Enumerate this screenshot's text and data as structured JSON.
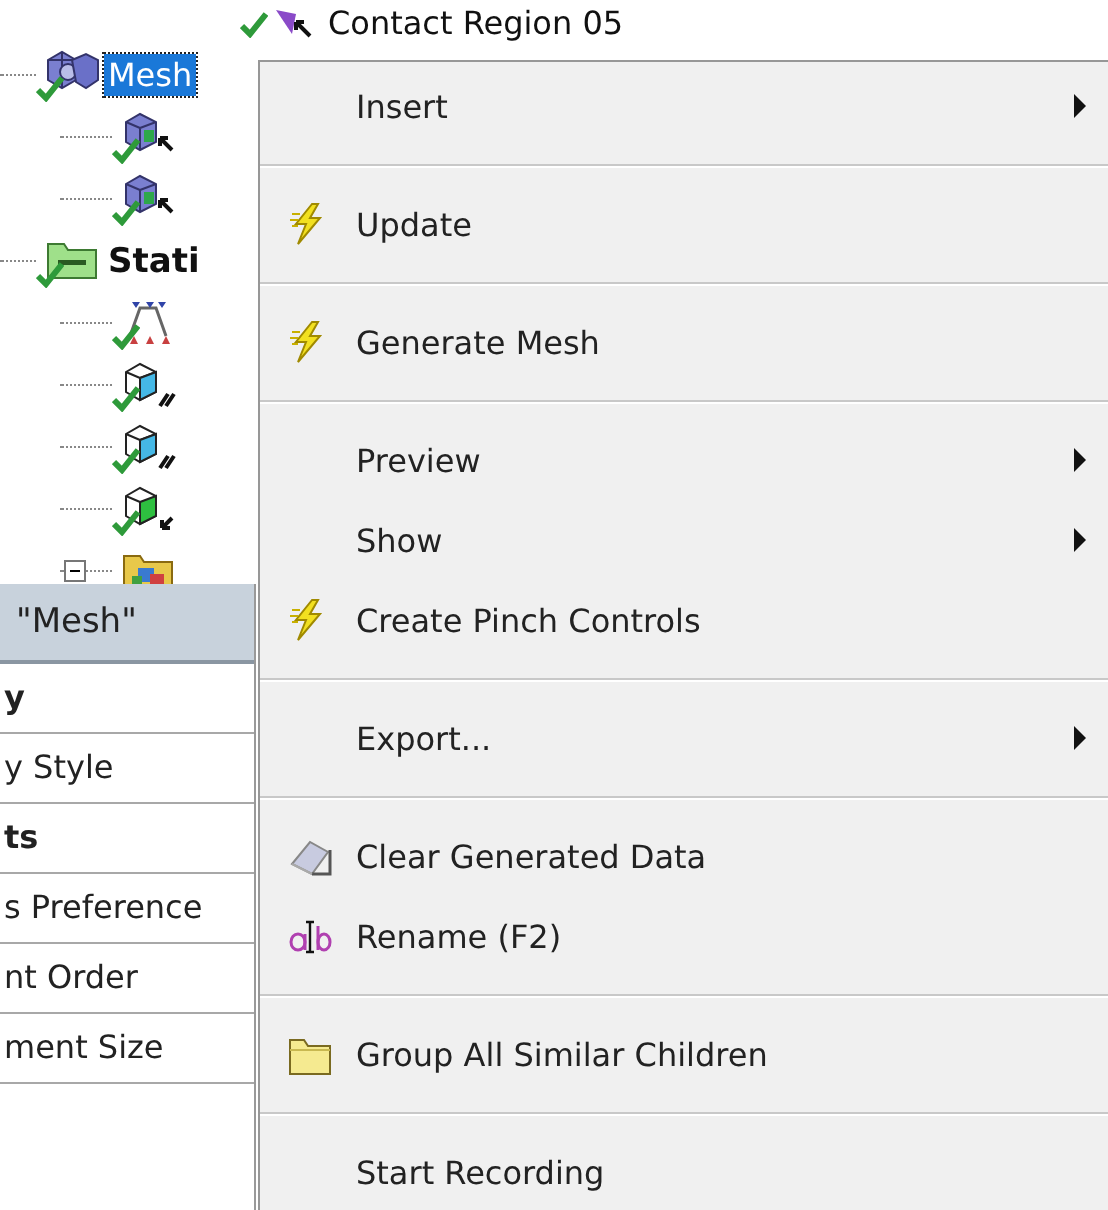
{
  "tree": {
    "above_item": {
      "label": "Contact Region 05",
      "checked": true
    },
    "items": [
      {
        "label": "Mesh",
        "kind": "mesh",
        "selected": true,
        "checked": true,
        "children": [
          {
            "kind": "sizing",
            "checked": true
          },
          {
            "kind": "sizing",
            "checked": true
          }
        ]
      },
      {
        "label": "Stati",
        "kind": "analysis",
        "selected": false,
        "checked": true,
        "children": [
          {
            "kind": "support",
            "checked": true
          },
          {
            "kind": "load",
            "checked": true
          },
          {
            "kind": "load",
            "checked": true
          },
          {
            "kind": "load-green",
            "checked": true
          },
          {
            "kind": "solution",
            "checked": false,
            "expanded": true
          }
        ]
      }
    ]
  },
  "details": {
    "title": "\"Mesh\"",
    "rows": [
      {
        "label": "y",
        "kind": "group"
      },
      {
        "label": "y Style",
        "kind": "field"
      },
      {
        "label": "ts",
        "kind": "group"
      },
      {
        "label": "s Preference",
        "kind": "field"
      },
      {
        "label": "nt Order",
        "kind": "field"
      },
      {
        "label": "ment Size",
        "kind": "field"
      }
    ]
  },
  "context_menu": {
    "items": [
      {
        "kind": "plain",
        "label": "Insert",
        "submenu": true
      },
      {
        "kind": "separator"
      },
      {
        "kind": "lightning",
        "label": "Update",
        "submenu": false
      },
      {
        "kind": "separator"
      },
      {
        "kind": "lightning",
        "label": "Generate Mesh",
        "submenu": false
      },
      {
        "kind": "separator"
      },
      {
        "kind": "plain",
        "label": "Preview",
        "submenu": true
      },
      {
        "kind": "plain",
        "label": "Show",
        "submenu": true
      },
      {
        "kind": "lightning",
        "label": "Create Pinch Controls",
        "submenu": false
      },
      {
        "kind": "separator"
      },
      {
        "kind": "plain",
        "label": "Export...",
        "submenu": true
      },
      {
        "kind": "separator"
      },
      {
        "kind": "eraser",
        "label": "Clear Generated Data",
        "submenu": false
      },
      {
        "kind": "rename",
        "label": "Rename (F2)",
        "submenu": false
      },
      {
        "kind": "separator"
      },
      {
        "kind": "folder",
        "label": "Group All Similar Children",
        "submenu": false
      },
      {
        "kind": "separator"
      },
      {
        "kind": "plain",
        "label": "Start Recording",
        "submenu": false
      }
    ]
  }
}
